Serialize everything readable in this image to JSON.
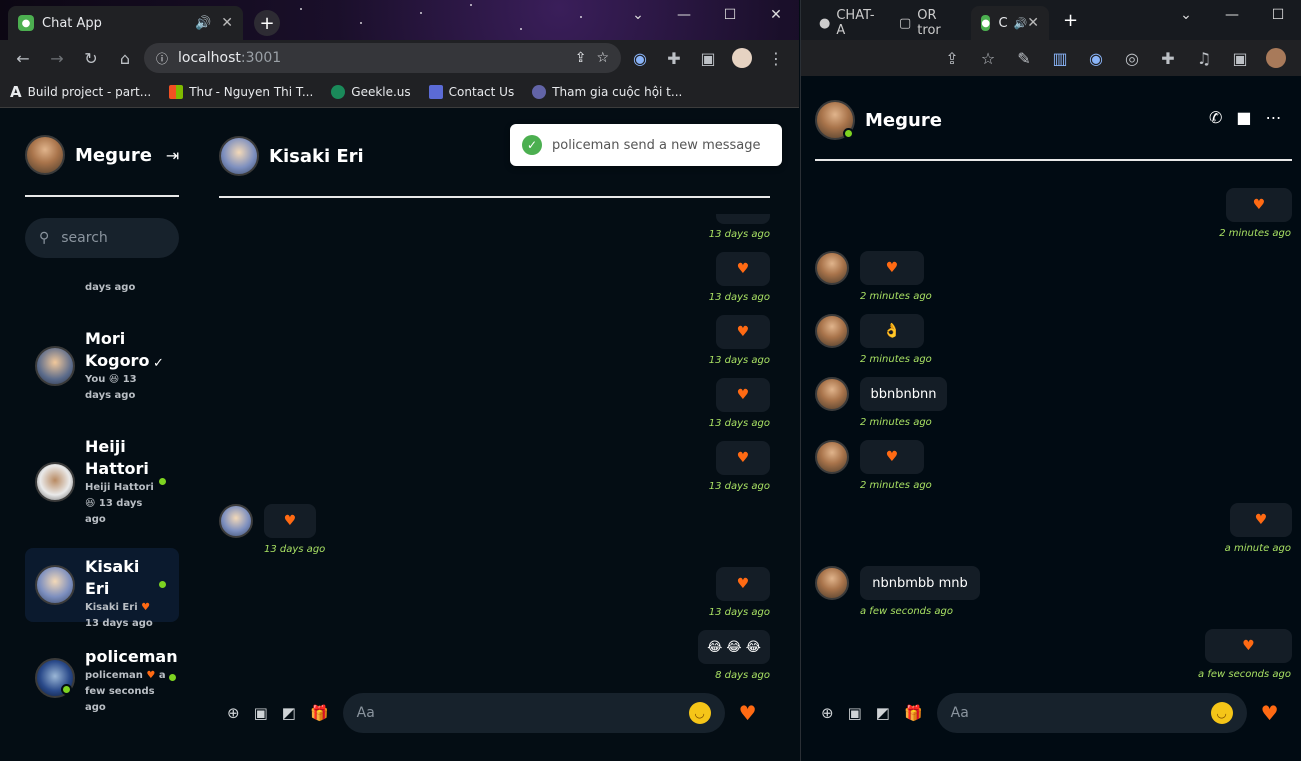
{
  "left_browser": {
    "tab_title": "Chat App",
    "url_host": "localhost",
    "url_port": ":3001",
    "bookmarks": [
      "Build project - part...",
      "Thư - Nguyen Thi T...",
      "Geekle.us",
      "Contact Us",
      "Tham gia cuộc hội t..."
    ]
  },
  "toast": {
    "message": "policeman send a new message"
  },
  "sidebar": {
    "me": "Megure",
    "search_placeholder": "search",
    "top_partial": "days ago",
    "contacts": [
      {
        "name1": "Mori",
        "name2": "Kogoro",
        "sub1": "You 😆 13",
        "sub2": "days ago"
      },
      {
        "name1": "Heiji",
        "name2": "Hattori",
        "sub1": "Heiji Hattori",
        "sub2": "😆 13 days",
        "sub3": "ago"
      },
      {
        "name1": "Kisaki Eri",
        "sub1": "Kisaki Eri",
        "sub2": "13 days ago"
      },
      {
        "name1": "policeman",
        "sub1": "policeman",
        "sub1b": "a",
        "sub2": "few seconds",
        "sub3": "ago"
      }
    ]
  },
  "chat": {
    "partner": "Kisaki Eri",
    "messages": [
      {
        "time": "13 days ago"
      },
      {
        "time": "13 days ago"
      },
      {
        "time": "13 days ago"
      },
      {
        "time": "13 days ago"
      },
      {
        "time": "13 days ago"
      },
      {
        "time": "13 days ago"
      },
      {
        "time": "13 days ago"
      },
      {
        "text": "😂 😂 😂",
        "time": "8 days ago"
      }
    ],
    "input_placeholder": "Aa"
  },
  "right_browser": {
    "tabs": [
      "CHAT-A",
      "OR tror",
      "C"
    ],
    "partner": "Megure",
    "messages": [
      {
        "time": "2 minutes ago"
      },
      {
        "time": "2 minutes ago"
      },
      {
        "text": "👌",
        "time": "2 minutes ago"
      },
      {
        "text": "bbnbnbnn",
        "time": "2 minutes ago"
      },
      {
        "time": "2 minutes ago"
      },
      {
        "time": "a minute ago"
      },
      {
        "text": "nbnbmbb mnb",
        "time": "a few seconds ago"
      },
      {
        "time": "a few seconds ago"
      }
    ],
    "input_placeholder": "Aa"
  },
  "colors": {
    "accent_heart": "#ff6a13",
    "online": "#7ed321",
    "timestamp": "#a8e063",
    "bg": "#040d14"
  }
}
